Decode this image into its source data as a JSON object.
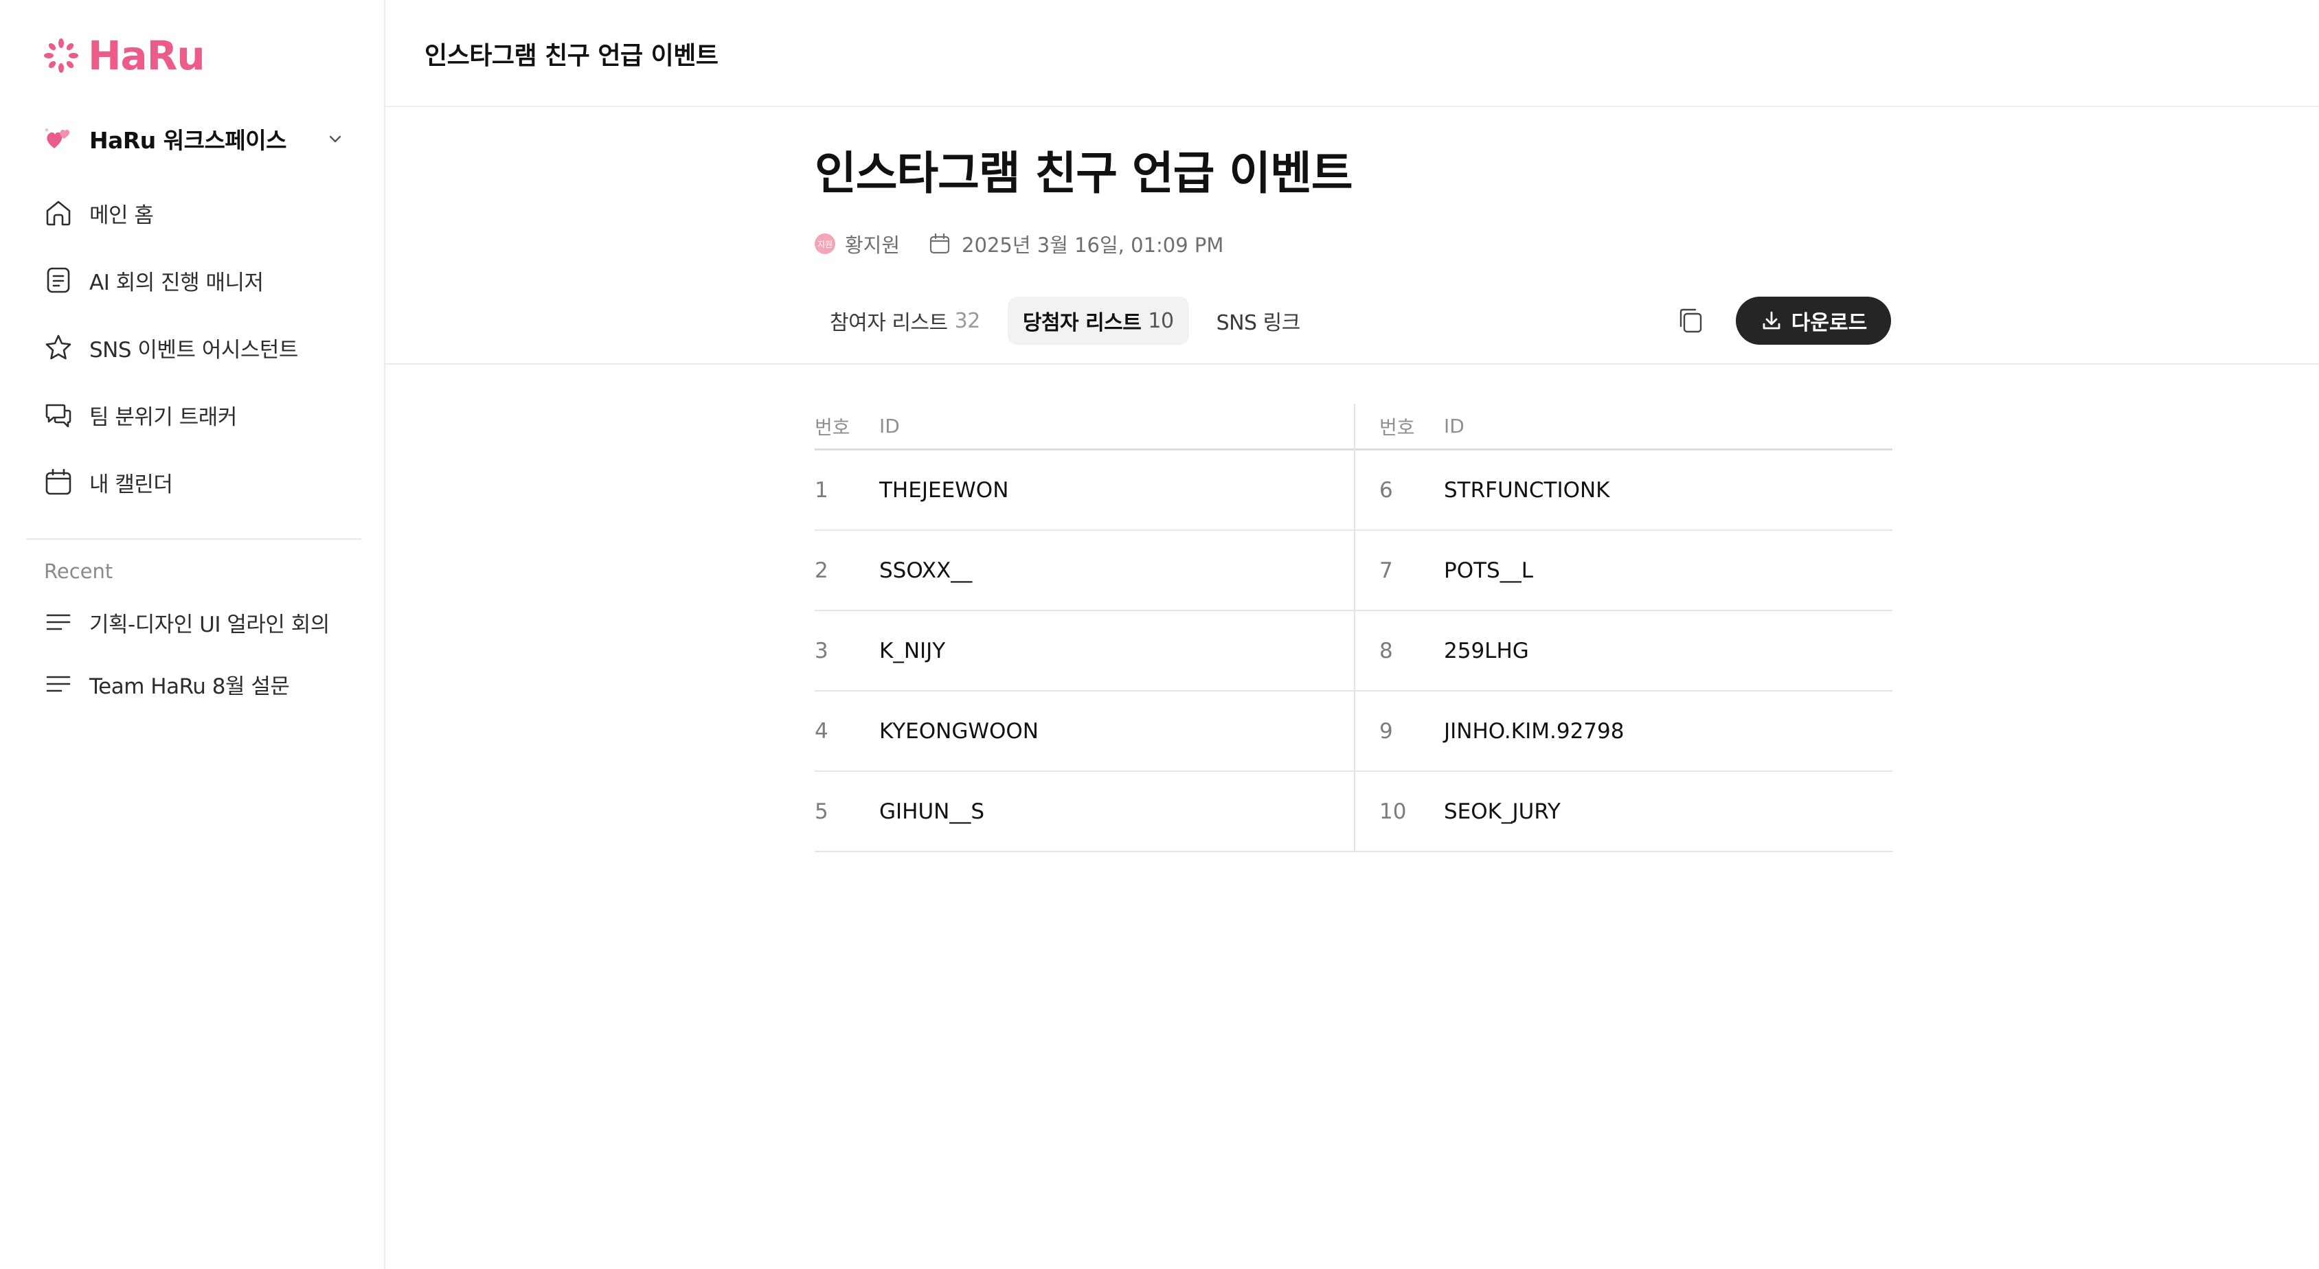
{
  "sidebar": {
    "logo": "HaRu",
    "workspace": "HaRu 워크스페이스",
    "nav": [
      {
        "label": "메인 홈",
        "icon": "home-icon"
      },
      {
        "label": "AI 회의 진행 매니저",
        "icon": "document-icon"
      },
      {
        "label": "SNS 이벤트 어시스턴트",
        "icon": "star-icon"
      },
      {
        "label": "팀 분위기 트래커",
        "icon": "chat-icon"
      },
      {
        "label": "내 캘린더",
        "icon": "calendar-icon"
      }
    ],
    "recent_label": "Recent",
    "recent": [
      {
        "label": "기획-디자인 UI 얼라인 회의",
        "icon": "lines-icon"
      },
      {
        "label": "Team HaRu 8월 설문",
        "icon": "lines-icon"
      }
    ]
  },
  "header": {
    "title": "인스타그램 친구 언급 이벤트"
  },
  "page": {
    "title": "인스타그램 친구 언급 이벤트",
    "author": "황지원",
    "avatar_text": "지원",
    "date": "2025년 3월 16일, 01:09 PM",
    "download_label": "다운로드"
  },
  "tabs": [
    {
      "label": "참여자 리스트",
      "count": "32"
    },
    {
      "label": "당첨자 리스트",
      "count": "10"
    },
    {
      "label": "SNS 링크",
      "count": ""
    }
  ],
  "table": {
    "headers": {
      "no": "번호",
      "id": "ID"
    },
    "left": [
      {
        "no": "1",
        "id": "THEJEEWON"
      },
      {
        "no": "2",
        "id": "SSOXX__"
      },
      {
        "no": "3",
        "id": "K_NIJY"
      },
      {
        "no": "4",
        "id": "KYEONGWOON"
      },
      {
        "no": "5",
        "id": "GIHUN__S"
      }
    ],
    "right": [
      {
        "no": "6",
        "id": "STRFUNCTIONK"
      },
      {
        "no": "7",
        "id": "POTS__L"
      },
      {
        "no": "8",
        "id": "259LHG"
      },
      {
        "no": "9",
        "id": "JINHO.KIM.92798"
      },
      {
        "no": "10",
        "id": "SEOK_JURY"
      }
    ]
  },
  "colors": {
    "brand": "#ec5c89",
    "button_dark": "#252525"
  }
}
